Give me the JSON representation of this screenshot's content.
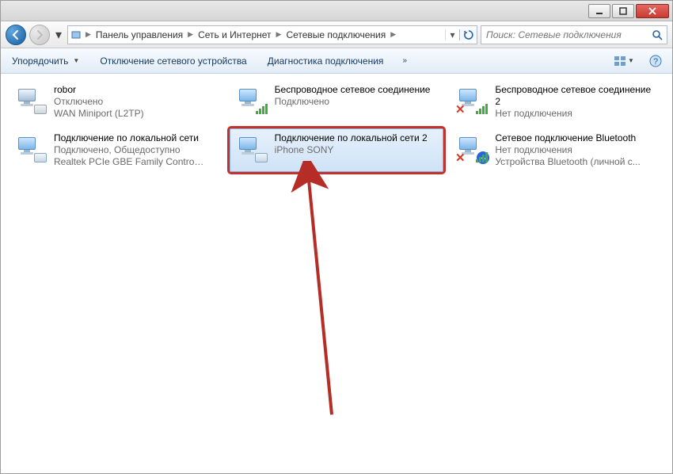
{
  "window": {
    "minimize_tip": "Свернуть",
    "maximize_tip": "Развернуть",
    "close_tip": "Закрыть"
  },
  "breadcrumbs": {
    "items": [
      "Панель управления",
      "Сеть и Интернет",
      "Сетевые подключения"
    ]
  },
  "search": {
    "placeholder": "Поиск: Сетевые подключения"
  },
  "toolbar": {
    "organize": "Упорядочить",
    "disable": "Отключение сетевого устройства",
    "diagnose": "Диагностика подключения"
  },
  "connections": [
    {
      "name": "robor",
      "status": "Отключено",
      "detail": "WAN Miniport (L2TP)",
      "icon": "lan-dim",
      "selected": false,
      "highlight": false
    },
    {
      "name": "Беспроводное сетевое соединение",
      "status": "Подключено",
      "detail": "",
      "icon": "wifi",
      "selected": false,
      "highlight": false
    },
    {
      "name": "Беспроводное сетевое соединение 2",
      "status": "Нет подключения",
      "detail": "",
      "icon": "wifi-x",
      "selected": false,
      "highlight": false
    },
    {
      "name": "Подключение по локальной сети",
      "status": "Подключено, Общедоступно",
      "detail": "Realtek PCIe GBE Family Controller",
      "icon": "lan",
      "selected": false,
      "highlight": false
    },
    {
      "name": "Подключение по локальной сети 2",
      "status": "",
      "detail": "iPhone SONY",
      "icon": "lan",
      "selected": true,
      "highlight": true
    },
    {
      "name": "Сетевое подключение Bluetooth",
      "status": "Нет подключения",
      "detail": "Устройства Bluetooth (личной с...",
      "icon": "bt-x",
      "selected": false,
      "highlight": false
    }
  ]
}
